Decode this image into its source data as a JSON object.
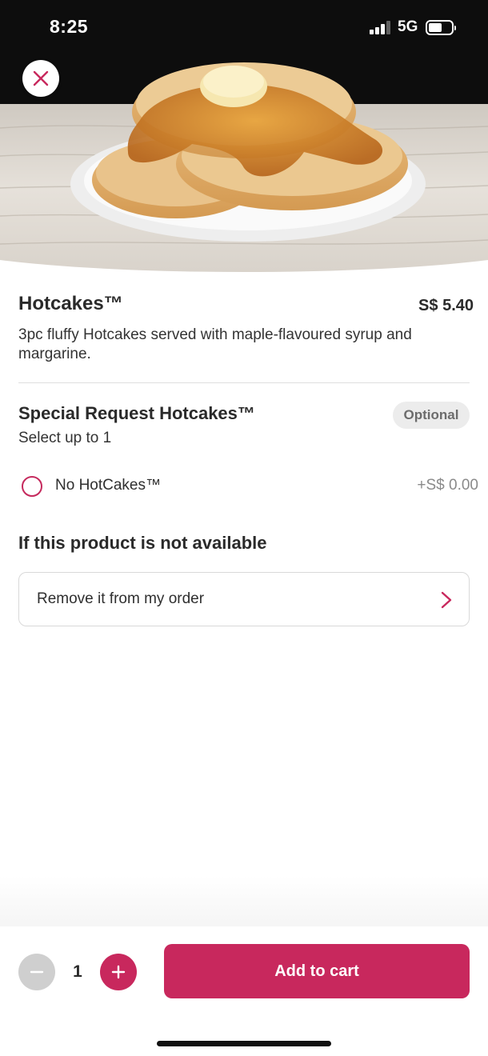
{
  "status_bar": {
    "time": "8:25",
    "network": "5G",
    "signal_bars_filled": 3,
    "signal_bars_total": 4,
    "battery_level": 0.6,
    "icons": [
      "signal-icon",
      "battery-icon"
    ]
  },
  "hero": {
    "image": "hotcakes-photo",
    "close_icon": "close-icon"
  },
  "product": {
    "name": "Hotcakes™",
    "price": "S$ 5.40",
    "description": "3pc fluffy Hotcakes served with maple-flavoured syrup and margarine."
  },
  "special_request": {
    "title": "Special Request Hotcakes™",
    "badge": "Optional",
    "subtitle": "Select up to 1",
    "options": [
      {
        "label": "No HotCakes™",
        "price": "+S$ 0.00",
        "selected": false
      }
    ]
  },
  "unavailable": {
    "title": "If this product is not available",
    "selected_value": "Remove it from my order",
    "chevron_icon": "chevron-right-icon"
  },
  "cart": {
    "quantity": "1",
    "minus_icon": "minus-icon",
    "plus_icon": "plus-icon",
    "add_label": "Add to cart"
  },
  "colors": {
    "accent": "#c8285d",
    "badge_bg": "#ececec",
    "disabled": "#cfcfcf"
  }
}
